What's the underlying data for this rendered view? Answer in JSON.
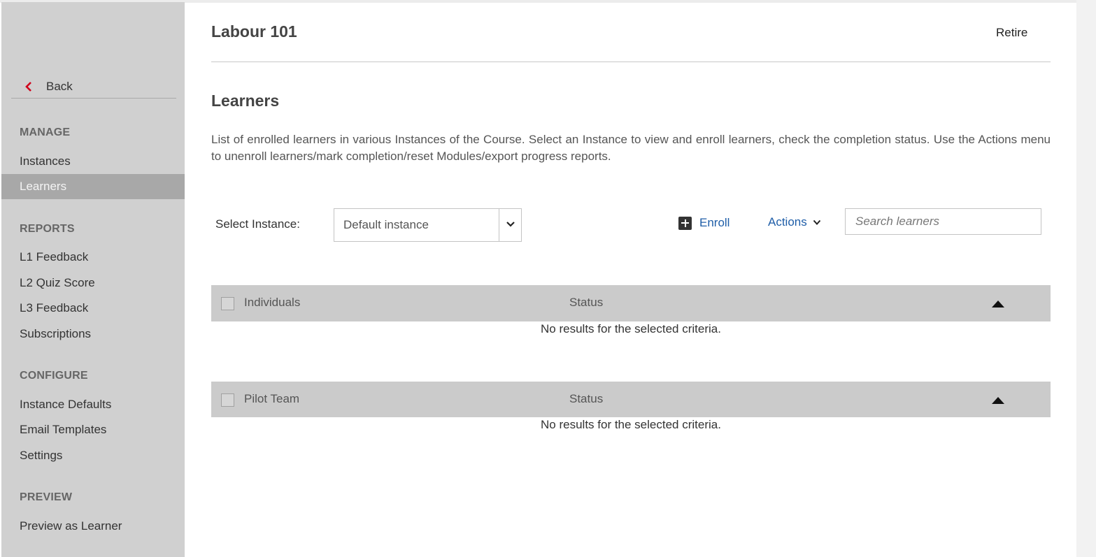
{
  "sidebar": {
    "back_label": "Back",
    "sections": {
      "manage": "MANAGE",
      "reports": "REPORTS",
      "configure": "CONFIGURE",
      "preview": "PREVIEW"
    },
    "items": {
      "instances": "Instances",
      "learners": "Learners",
      "l1_feedback": "L1 Feedback",
      "l2_quiz_score": "L2 Quiz Score",
      "l3_feedback": "L3 Feedback",
      "subscriptions": "Subscriptions",
      "instance_defaults": "Instance Defaults",
      "email_templates": "Email Templates",
      "settings": "Settings",
      "preview_as_learner": "Preview as Learner"
    },
    "active_item": "Learners"
  },
  "header": {
    "course_title": "Labour 101",
    "retire_label": "Retire"
  },
  "main": {
    "section_title": "Learners",
    "description": "List of enrolled learners in various Instances of the Course. Select an Instance to view and enroll learners, check the completion status. Use the Actions menu to unenroll learners/mark completion/reset Modules/export progress reports.",
    "select_label": "Select Instance:",
    "selected_instance": "Default instance",
    "enroll_label": "Enroll",
    "actions_label": "Actions",
    "search_placeholder": "Search learners",
    "groups": [
      {
        "name": "Individuals",
        "status_header": "Status",
        "empty_message": "No results for the selected criteria."
      },
      {
        "name": "Pilot Team",
        "status_header": "Status",
        "empty_message": "No results for the selected criteria."
      }
    ]
  },
  "colors": {
    "accent_red": "#d0021b",
    "link_blue": "#1f5ea8",
    "sidebar_bg": "#d0d0d0",
    "sidebar_active_bg": "#a8a8a8",
    "group_header_bg": "#cbcbcb"
  },
  "icons": {
    "back": "chevron-left-icon",
    "select_caret": "chevron-down-icon",
    "enroll": "plus-square-icon",
    "actions_caret": "chevron-down-icon",
    "collapse": "triangle-up-icon"
  }
}
